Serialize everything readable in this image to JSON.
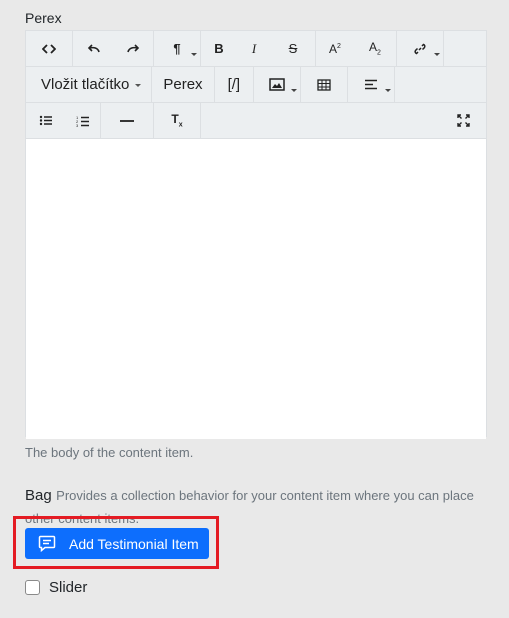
{
  "field": {
    "label": "Perex"
  },
  "toolbar": {
    "row1": [
      "code-view",
      "undo",
      "redo",
      "paragraph",
      "bold",
      "italic",
      "strikethrough",
      "superscript",
      "subscript",
      "link"
    ],
    "button_select": "Vložit tlačítko",
    "perex_label": "Perex",
    "shortcode_label": "[/]",
    "fullscreen": "expand"
  },
  "editor": {
    "hint": "The body of the content item."
  },
  "bag": {
    "title": "Bag",
    "description": "Provides a collection behavior for your content item where you can place other content items."
  },
  "add_button": {
    "label": "Add Testimonial Item"
  },
  "slider": {
    "label": "Slider",
    "checked": false
  },
  "colors": {
    "primary": "#0d6efd",
    "highlight": "#e41b23"
  }
}
